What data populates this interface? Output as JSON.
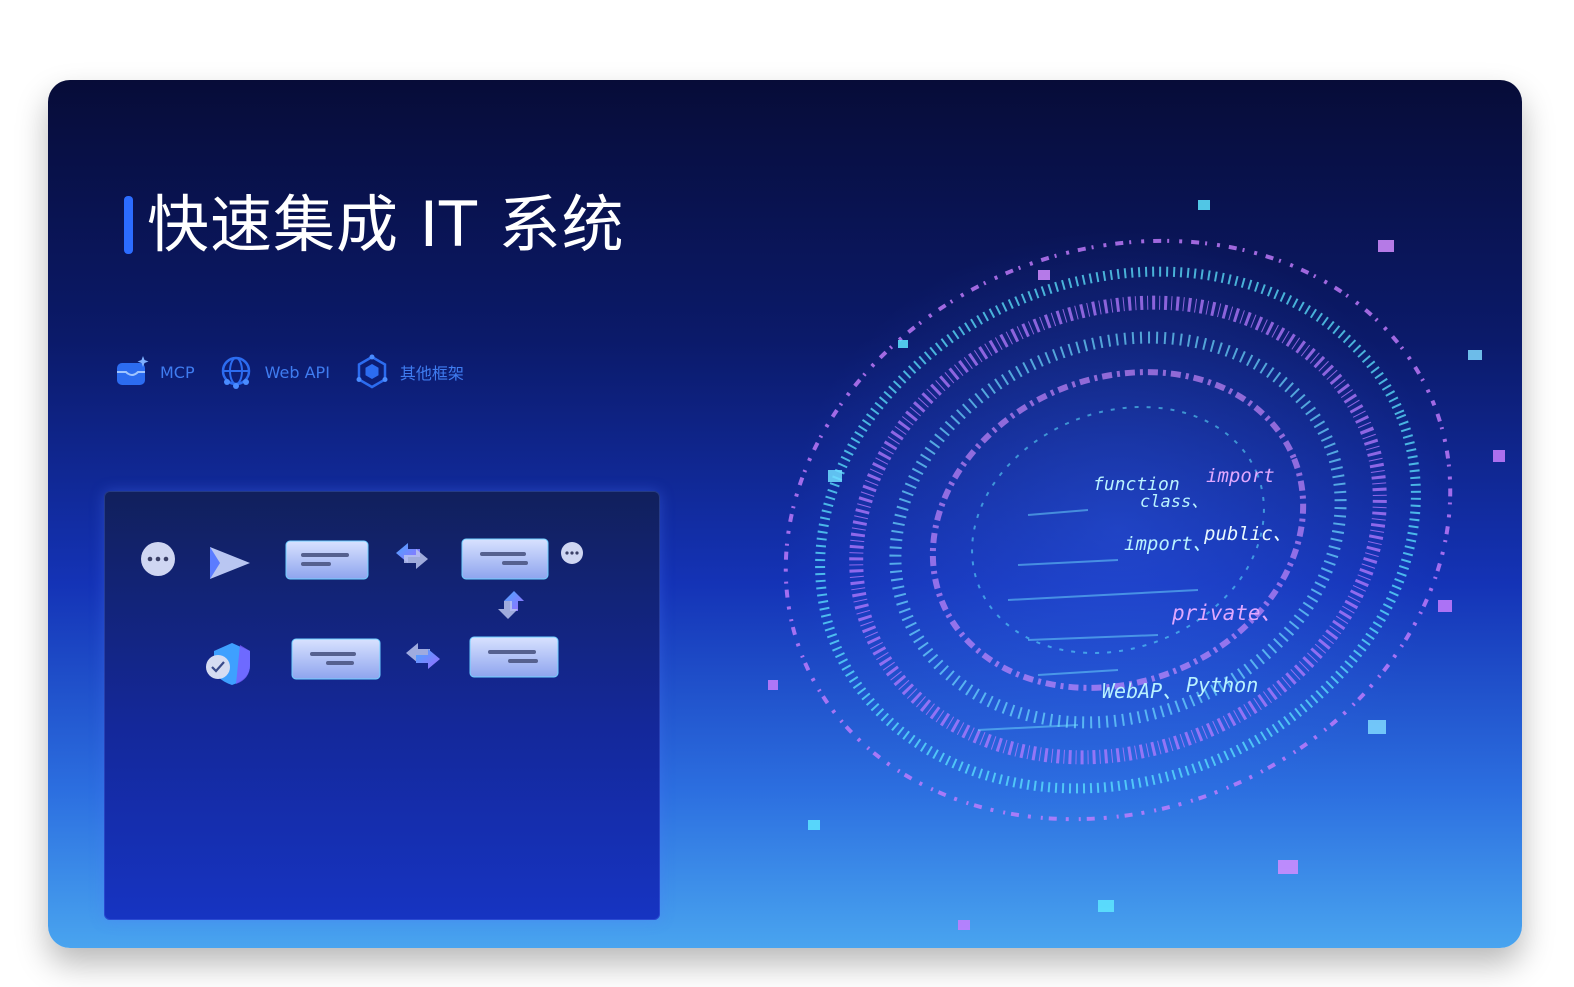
{
  "page": {
    "title": "快速集成 IT 系统"
  },
  "features": [
    {
      "label": "MCP",
      "icon": "mcp-box-icon"
    },
    {
      "label": "Web API",
      "icon": "globe-network-icon"
    },
    {
      "label": "其他框架",
      "icon": "hexagon-cluster-icon"
    }
  ],
  "hero": {
    "code_words": [
      "function",
      "class、",
      "import",
      "import、",
      "public、",
      "private、",
      "WebAP、",
      "Python"
    ]
  },
  "colors": {
    "accent": "#2c6cff",
    "feature_text": "#3f7cf0",
    "neon_cyan": "#5ee6ff",
    "neon_purple": "#c77dff"
  }
}
